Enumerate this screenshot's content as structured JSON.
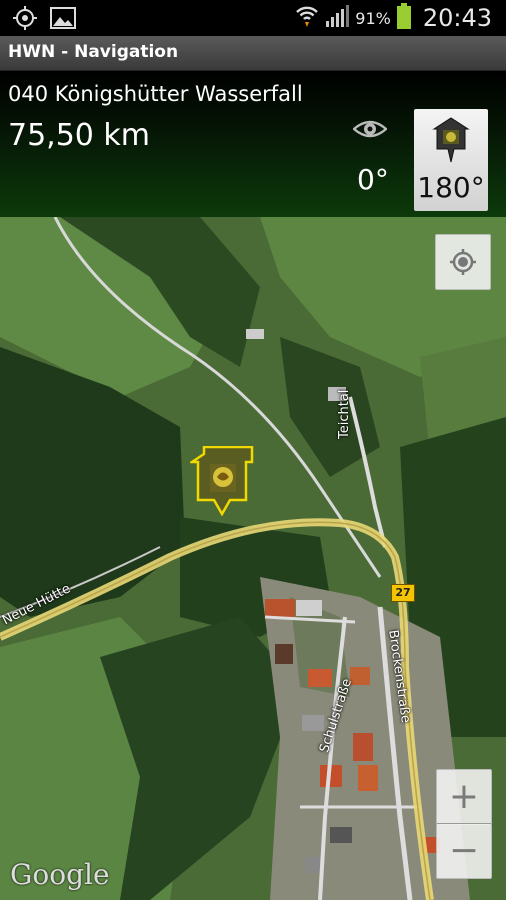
{
  "status_bar": {
    "left_icons": [
      "gps-icon",
      "gallery-icon"
    ],
    "right_icons": [
      "wifi-icon",
      "signal-icon",
      "battery-icon"
    ],
    "battery": "91%",
    "time": "20:43"
  },
  "app": {
    "title": "HWN - Navigation"
  },
  "navigation": {
    "destination": "040 Königshütter Wasserfall",
    "distance": "75,50 km",
    "heading": "0°",
    "target_bearing": "180°",
    "icons": [
      "eye-icon",
      "stamp-hut-icon"
    ]
  },
  "map": {
    "labels": {
      "neue_huette": "Neue Hütte",
      "teichtal": "Teichtal",
      "schulstrasse": "Schulstraße",
      "brockenstrasse": "Brockenstraße"
    },
    "road_number": "27",
    "attribution": "Google",
    "controls": {
      "zoom_in": "+",
      "zoom_out": "−"
    },
    "colors": {
      "route": "#e9d877",
      "poi_outline": "#f0d800",
      "poi_fill": "#5c5a1e"
    }
  }
}
